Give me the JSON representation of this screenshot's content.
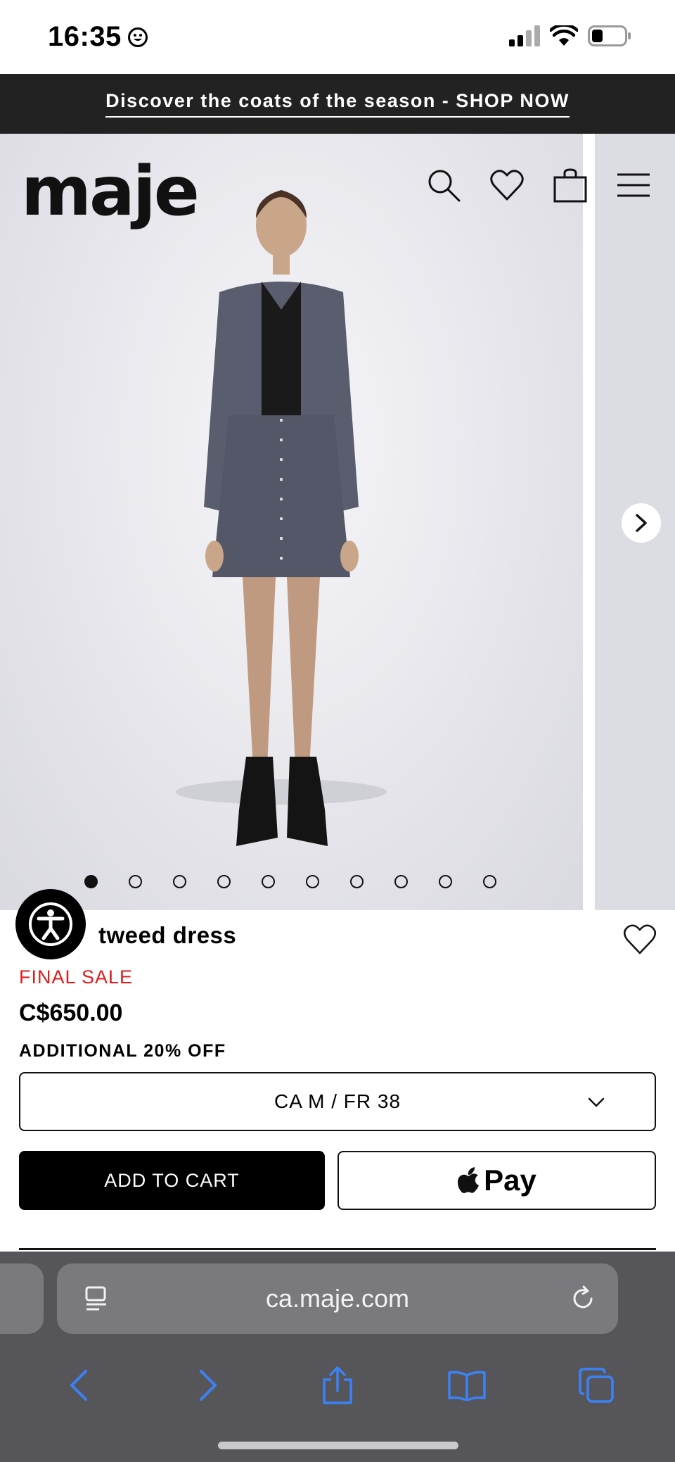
{
  "status_bar": {
    "time": "16:35"
  },
  "promo_banner": {
    "text": "Discover the coats of the season - SHOP NOW"
  },
  "header": {
    "logo": "maje"
  },
  "gallery": {
    "dot_count": 10,
    "active_index": 0
  },
  "product": {
    "name": "tweed dress",
    "sale_label": "FINAL SALE",
    "price": "C$650.00",
    "promo": "ADDITIONAL 20% OFF",
    "size_selected": "CA M / FR 38",
    "add_to_cart_label": "ADD TO CART",
    "apple_pay_label": "Pay"
  },
  "browser": {
    "url": "ca.maje.com"
  },
  "colors": {
    "sale_red": "#e01b1b",
    "safari_blue": "#3b82f6",
    "banner_bg": "#222222"
  }
}
